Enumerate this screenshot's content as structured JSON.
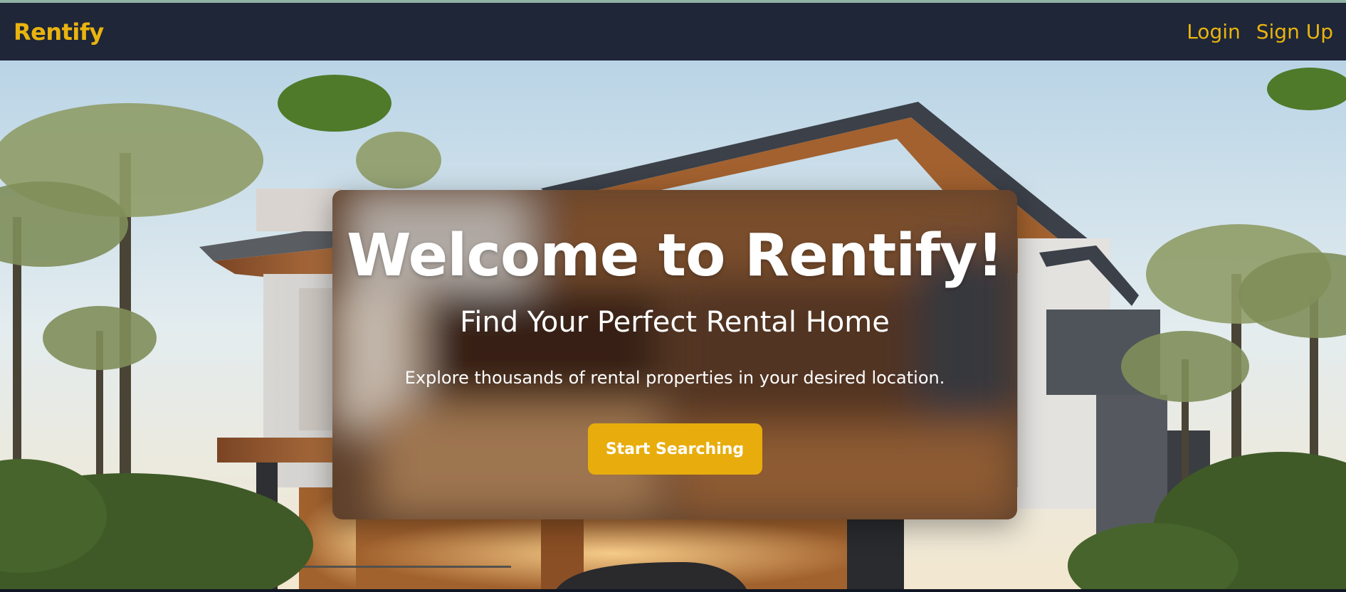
{
  "navbar": {
    "brand": "Rentify",
    "links": [
      {
        "label": "Login"
      },
      {
        "label": "Sign Up"
      }
    ]
  },
  "hero": {
    "title": "Welcome to Rentify!",
    "subtitle": "Find Your Perfect Rental Home",
    "description": "Explore thousands of rental properties in your desired location.",
    "cta_label": "Start Searching",
    "background_subject": "modern-house-with-palm-trees"
  },
  "colors": {
    "navbar_bg": "#1e2638",
    "accent": "#eab40e",
    "button_bg": "#e8ad0d",
    "text_light": "#ffffff"
  }
}
